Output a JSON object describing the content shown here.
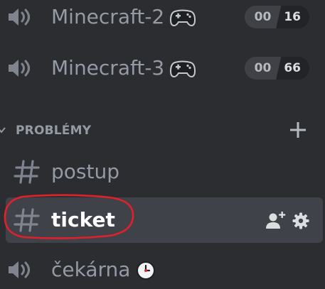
{
  "channels": {
    "minecraft2": {
      "name": "Minecraft-2",
      "icon": "controller-icon",
      "user_count": "00",
      "user_limit": "16"
    },
    "minecraft3": {
      "name": "Minecraft-3",
      "icon": "controller-icon",
      "user_count": "00",
      "user_limit": "66"
    }
  },
  "category": {
    "label": "PROBLÉMY",
    "add_icon": "plus-icon"
  },
  "text_channels": [
    {
      "name": "postup"
    },
    {
      "name": "ticket"
    }
  ],
  "waiting_room": {
    "name": "čekárna",
    "icon": "clock-icon"
  },
  "colors": {
    "background": "#2b2d31",
    "selected_background": "#404249",
    "muted_text": "#949ba4",
    "selected_text": "#ffffff",
    "annotation": "#e0212b"
  }
}
